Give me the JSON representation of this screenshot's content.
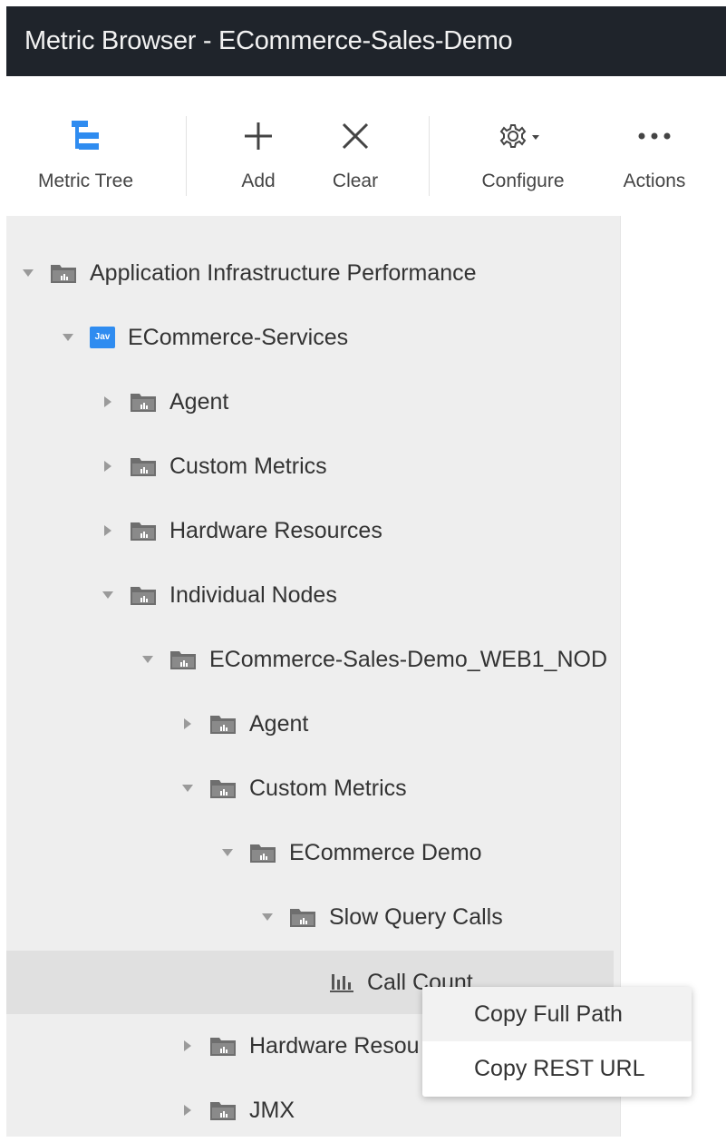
{
  "window": {
    "title": "Metric Browser - ECommerce-Sales-Demo"
  },
  "toolbar": {
    "metric_tree": "Metric Tree",
    "add": "Add",
    "clear": "Clear",
    "configure": "Configure",
    "actions": "Actions",
    "icons": {
      "metric_tree": "metric-tree-icon",
      "add": "plus-icon",
      "clear": "close-icon",
      "configure": "gear-icon",
      "actions": "more-icon"
    },
    "accent": "#2f8cf0"
  },
  "tree": {
    "rows": [
      {
        "label": "Application Infrastructure Performance",
        "state": "expanded",
        "icon": "folder"
      },
      {
        "label": "ECommerce-Services",
        "state": "expanded",
        "icon": "java",
        "icon_text": "Jav"
      },
      {
        "label": "Agent",
        "state": "collapsed",
        "icon": "folder"
      },
      {
        "label": "Custom Metrics",
        "state": "collapsed",
        "icon": "folder"
      },
      {
        "label": "Hardware Resources",
        "state": "collapsed",
        "icon": "folder"
      },
      {
        "label": "Individual Nodes",
        "state": "expanded",
        "icon": "folder"
      },
      {
        "label": "ECommerce-Sales-Demo_WEB1_NOD",
        "state": "expanded",
        "icon": "folder"
      },
      {
        "label": "Agent",
        "state": "collapsed",
        "icon": "folder"
      },
      {
        "label": "Custom Metrics",
        "state": "expanded",
        "icon": "folder"
      },
      {
        "label": "ECommerce Demo",
        "state": "expanded",
        "icon": "folder"
      },
      {
        "label": "Slow Query Calls",
        "state": "expanded",
        "icon": "folder"
      },
      {
        "label": "Call Count",
        "state": "leaf",
        "icon": "bar-chart",
        "selected": true
      },
      {
        "label": "Hardware Resou",
        "state": "collapsed",
        "icon": "folder"
      },
      {
        "label": "JMX",
        "state": "collapsed",
        "icon": "folder"
      }
    ]
  },
  "context_menu": {
    "items": [
      {
        "label": "Copy Full Path",
        "hover": true
      },
      {
        "label": "Copy REST URL"
      }
    ]
  }
}
